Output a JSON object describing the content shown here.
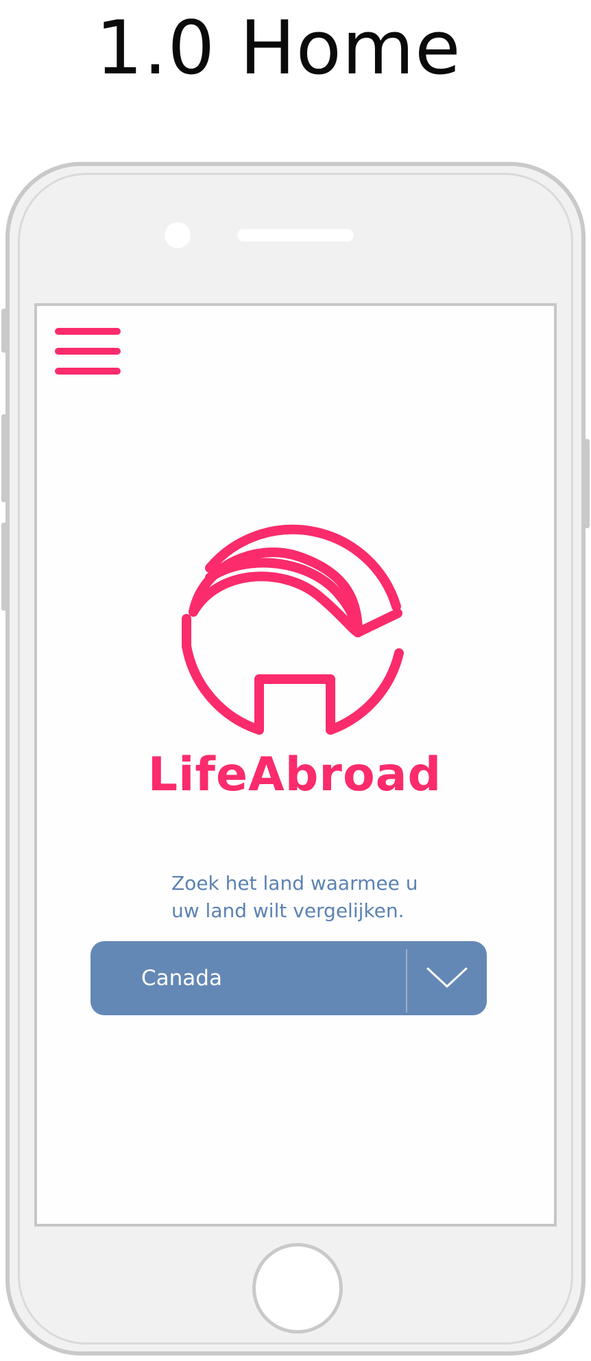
{
  "page_heading": "1.0 Home",
  "app": {
    "brand_name": "LifeAbroad",
    "menu_icon": "hamburger-menu-icon",
    "logo_icon": "house-globe-logo-icon",
    "prompt_line_1": "Zoek het land waarmee u",
    "prompt_line_2": "uw land wilt vergelijken.",
    "country_select": {
      "selected_value": "Canada",
      "icon": "chevron-down-icon"
    }
  },
  "device": {
    "frame": "smartphone-frame",
    "home_button_icon": "home-button"
  },
  "colors": {
    "brand_pink": "#fb2b6c",
    "select_blue": "#6488b5",
    "prompt_text": "#5b82b2",
    "device_frame": "#c9c9c9",
    "device_body": "#f1f1f1"
  }
}
